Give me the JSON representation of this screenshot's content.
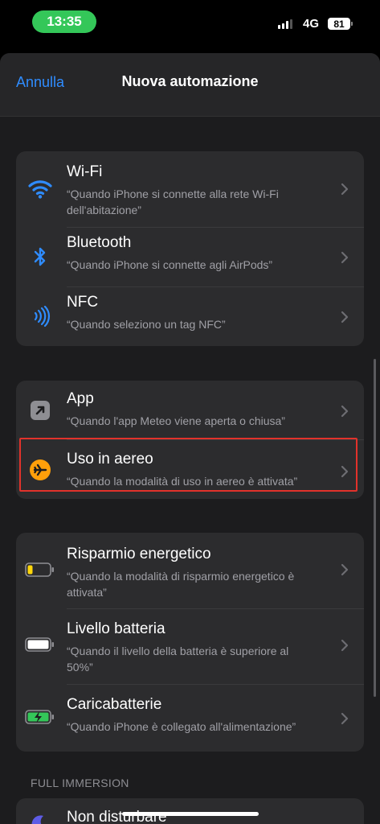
{
  "status": {
    "time": "13:35",
    "network": "4G",
    "battery": "81"
  },
  "nav": {
    "cancel": "Annulla",
    "title": "Nuova automazione"
  },
  "groups": [
    {
      "rows": [
        {
          "title": "Wi-Fi",
          "subtitle": "“Quando iPhone si connette alla rete Wi-Fi dell'abitazione”",
          "icon": "wifi-icon"
        },
        {
          "title": "Bluetooth",
          "subtitle": "“Quando iPhone si connette agli AirPods”",
          "icon": "bluetooth-icon"
        },
        {
          "title": "NFC",
          "subtitle": "“Quando seleziono un tag NFC”",
          "icon": "nfc-icon"
        }
      ]
    },
    {
      "rows": [
        {
          "title": "App",
          "subtitle": "“Quando l'app Meteo viene aperta o chiusa”",
          "icon": "app-arrow-icon"
        },
        {
          "title": "Uso in aereo",
          "subtitle": "“Quando la modalità di uso in aereo è attivata”",
          "icon": "airplane-icon"
        }
      ]
    },
    {
      "rows": [
        {
          "title": "Risparmio energetico",
          "subtitle": "“Quando la modalità di risparmio energetico è attivata”",
          "icon": "low-power-battery-icon"
        },
        {
          "title": "Livello batteria",
          "subtitle": "“Quando il livello della batteria è superiore al 50%”",
          "icon": "battery-level-icon"
        },
        {
          "title": "Caricabatterie",
          "subtitle": "“Quando iPhone è collegato all'alimentazione”",
          "icon": "charging-battery-icon"
        }
      ]
    }
  ],
  "section_header": "FULL IMMERSION",
  "partial_row": {
    "title": "Non disturbare",
    "icon": "moon-icon"
  },
  "colors": {
    "accent": "#2f8cff",
    "highlight": "#e2322b",
    "airplane": "#ff9f0a",
    "low_power": "#ffd60a",
    "charging": "#34c759"
  }
}
